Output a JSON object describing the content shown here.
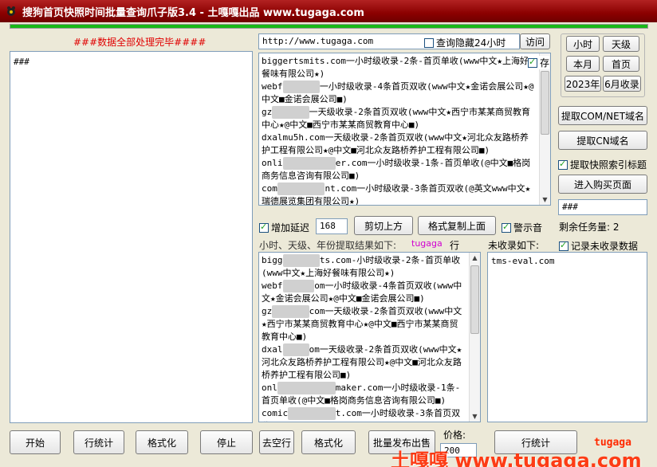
{
  "window": {
    "title": "搜狗首页快照时间批量查询爪子版3.4 - 土嘎嘎出品 www.tugaga.com"
  },
  "progress": {
    "fraction": 1.0
  },
  "status_text": "###数据全部处理完毕####",
  "left_log": "###",
  "url": {
    "value": "http://www.tugaga.com",
    "hide_24h_label": "查询隐藏24小时",
    "visit_label": "访问"
  },
  "results_top": {
    "keep_label": "存",
    "lines": [
      {
        "pre": "biggertsmits.com",
        "post": "一小时级收录-2条-首页单收(www中文★上海好餐味有限公司★)"
      },
      {
        "pre": "webf",
        "blur": "xxxxxxx",
        "post": "一小时级收录-4条首页双收(www中文★金诺会展公司★@中文■金诺会展公司■)"
      },
      {
        "pre": "gz",
        "blur": "xxxxxxx",
        "post": "一天级收录-2条首页双收(www中文★西宁市某某商贸教育中心★@中文■西宁市某某商贸教育中心■)"
      },
      {
        "pre": "dxalmu5h.com",
        "post": "一天级收录-2条首页双收(www中文★河北众友路桥养护工程有限公司★@中文■河北众友路桥养护工程有限公司■)"
      },
      {
        "pre": "onli",
        "blur": "xxxxxxxxxx",
        "post": "er.com一小时级收录-1条-首页单收(@中文■格岗商务信息咨询有限公司■)"
      },
      {
        "pre": "com",
        "blur": "xxxxxxxxx",
        "post": "nt.com一小时级收录-3条首页双收(@英文www中文★瑞德展览集团有限公司★)"
      }
    ]
  },
  "right_top": {
    "hour": "小时",
    "day": "天级",
    "month": "本月",
    "home": "首页",
    "year": "2023年",
    "month6": "6月收录"
  },
  "buttons": {
    "extract_com": "提取COM/NET域名",
    "extract_cn": "提取CN域名",
    "extract_index_label": "提取快照索引标题",
    "enter_buy": "进入购买页面",
    "hash_value": "###",
    "start": "开始",
    "line_count": "行统计",
    "format": "格式化",
    "stop": "停止",
    "trim": "去空行",
    "format2": "格式化",
    "batch_publish": "批量发布出售",
    "price_label": "价格:",
    "price_value": "200",
    "line_count2": "行统计"
  },
  "middle_bar": {
    "add_delay_label": "增加延迟",
    "delay_value": "168",
    "cut_up": "剪切上方",
    "copy_format_up": "格式复制上面",
    "alert_sound_label": "警示音",
    "remaining_label": "剩余任务量:",
    "remaining_value": "2"
  },
  "labels": {
    "result_heading": "小时、天级、年份提取结果如下:",
    "tugaga_tag": "tugaga",
    "row_suffix": "行",
    "unincluded_heading": "未收录如下:",
    "record_unincluded_label": "记录未收录数据"
  },
  "results_bottom": {
    "lines": [
      {
        "pre": "bigg",
        "blur": "xxxxxxx",
        "post": "ts.com-小时级收录-2条-首页单收(www中文★上海好餐味有限公司★)"
      },
      {
        "pre": "webf",
        "blur": "xxxxxx",
        "post": "om一小时级收录-4条首页双收(www中文★金诺会展公司★@中文■金诺会展公司■)"
      },
      {
        "pre": "gz",
        "blur": "xxxxxxx",
        "post": "com一天级收录-2条首页双收(www中文★西宁市某某商贸教育中心★@中文■西宁市某某商贸教育中心■)"
      },
      {
        "pre": "dxal",
        "blur": "xxxxx",
        "post": "om一天级收录-2条首页双收(www中文★河北众友路桥养护工程有限公司★@中文■河北众友路桥养护工程有限公司■)"
      },
      {
        "pre": "onl",
        "blur": "xxxxxxxxxxx",
        "post": "maker.com一小时级收录-1条-首页单收(@中文■格岗商务信息咨询有限公司■)"
      },
      {
        "pre": "comic",
        "blur": "xxxxxxxxx",
        "post": "t.com一小时级收录-3条首页双收"
      }
    ]
  },
  "unincluded": {
    "text": "tms-eval.com"
  },
  "watermark": {
    "big": "土嘎嘎 www.tugaga.com",
    "small": "tugaga"
  },
  "colors": {
    "title_bg": "#8b0000",
    "status": "#e00000",
    "progress": "#18b818",
    "tag": "#d000d0"
  }
}
